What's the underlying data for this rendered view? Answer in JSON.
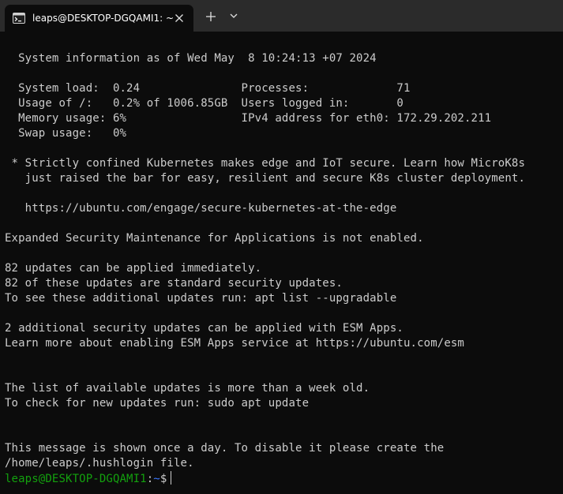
{
  "window": {
    "tab_title": "leaps@DESKTOP-DGQAMI1: ~",
    "tab_icon": "terminal-icon",
    "close_icon": "close-icon",
    "new_tab_icon": "plus-icon",
    "dropdown_icon": "chevron-down-icon"
  },
  "terminal": {
    "lines": [
      "  System information as of Wed May  8 10:24:13 +07 2024",
      "",
      "  System load:  0.24               Processes:             71",
      "  Usage of /:   0.2% of 1006.85GB  Users logged in:       0",
      "  Memory usage: 6%                 IPv4 address for eth0: 172.29.202.211",
      "  Swap usage:   0%",
      "",
      " * Strictly confined Kubernetes makes edge and IoT secure. Learn how MicroK8s",
      "   just raised the bar for easy, resilient and secure K8s cluster deployment.",
      "",
      "   https://ubuntu.com/engage/secure-kubernetes-at-the-edge",
      "",
      "Expanded Security Maintenance for Applications is not enabled.",
      "",
      "82 updates can be applied immediately.",
      "82 of these updates are standard security updates.",
      "To see these additional updates run: apt list --upgradable",
      "",
      "2 additional security updates can be applied with ESM Apps.",
      "Learn more about enabling ESM Apps service at https://ubuntu.com/esm",
      "",
      "",
      "The list of available updates is more than a week old.",
      "To check for new updates run: sudo apt update",
      "",
      "",
      "This message is shown once a day. To disable it please create the",
      "/home/leaps/.hushlogin file."
    ],
    "prompt": {
      "user_host": "leaps@DESKTOP-DGQAMI1",
      "separator": ":",
      "path": "~",
      "symbol": "$"
    }
  },
  "colors": {
    "background": "#0c0c0c",
    "titlebar": "#2b2b2b",
    "foreground": "#cccccc",
    "prompt_user": "#13a10e",
    "prompt_path": "#3b78ff"
  }
}
